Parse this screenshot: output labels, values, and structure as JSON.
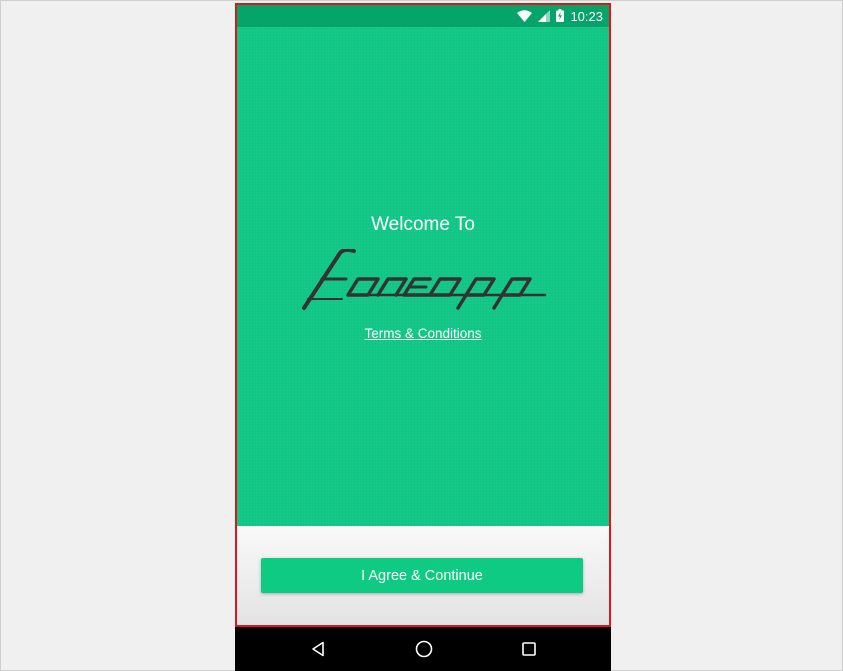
{
  "status_bar": {
    "time": "10:23",
    "icons": [
      "wifi-icon",
      "signal-icon",
      "battery-charging-icon"
    ]
  },
  "hero": {
    "welcome_text": "Welcome To",
    "logo_text": "foneapp",
    "terms_link": "Terms & Conditions"
  },
  "footer": {
    "agree_button_label": "I Agree & Continue"
  },
  "nav_bar": {
    "buttons": [
      "back-icon",
      "home-icon",
      "recents-icon"
    ]
  },
  "colors": {
    "primary": "#12c886",
    "status_bar": "#07a46a",
    "button": "#0fca82",
    "logo": "#333333",
    "highlight_border": "#d9181c"
  }
}
